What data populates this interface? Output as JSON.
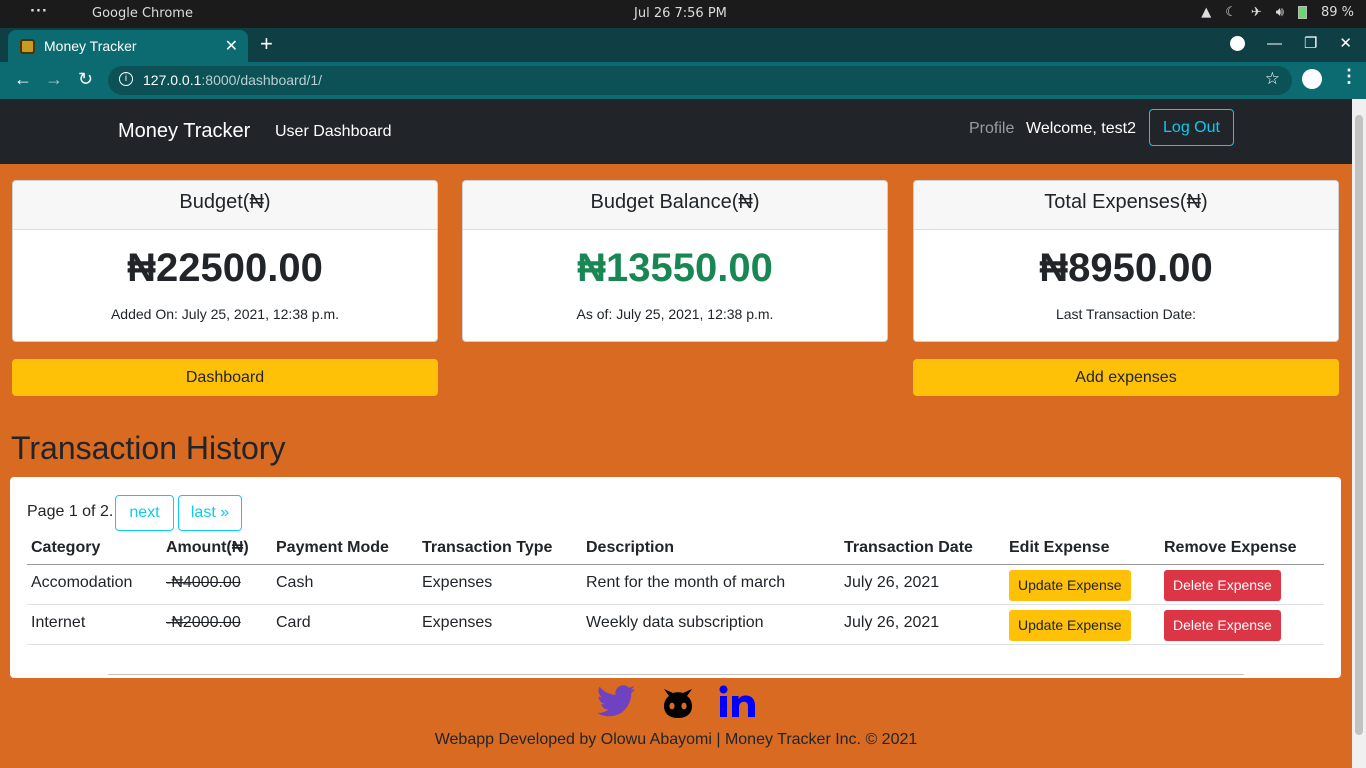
{
  "os": {
    "app_name": "Google Chrome",
    "datetime": "Jul 26   7:56 PM",
    "battery": "89 %"
  },
  "browser": {
    "tab_title": "Money Tracker",
    "url_host": "127.0.0.1",
    "url_rest": ":8000/dashboard/1/"
  },
  "nav": {
    "brand": "Money Tracker",
    "link": "User Dashboard",
    "profile": "Profile",
    "welcome": "Welcome, test2",
    "logout": "Log Out"
  },
  "cards": [
    {
      "title": "Budget(₦)",
      "value": "₦22500.00",
      "sub": "Added On: July 25, 2021, 12:38 p.m."
    },
    {
      "title": "Budget Balance(₦)",
      "value": "₦13550.00",
      "sub": "As of: July 25, 2021, 12:38 p.m."
    },
    {
      "title": "Total Expenses(₦)",
      "value": "₦8950.00",
      "sub": "Last Transaction Date:"
    }
  ],
  "buttons": {
    "dashboard": "Dashboard",
    "add_expenses": "Add expenses"
  },
  "history": {
    "title": "Transaction History",
    "page_info": "Page 1 of 2.",
    "next": "next",
    "last": "last »",
    "columns": [
      "Category",
      "Amount(₦)",
      "Payment Mode",
      "Transaction Type",
      "Description",
      "Transaction Date",
      "Edit Expense",
      "Remove Expense"
    ],
    "rows": [
      {
        "category": "Accomodation",
        "amount": "-₦4000.00",
        "mode": "Cash",
        "type": "Expenses",
        "description": "Rent for the month of march",
        "date": "July 26, 2021",
        "update": "Update Expense",
        "delete": "Delete Expense"
      },
      {
        "category": "Internet",
        "amount": "-₦2000.00",
        "mode": "Card",
        "type": "Expenses",
        "description": "Weekly data subscription",
        "date": "July 26, 2021",
        "update": "Update Expense",
        "delete": "Delete Expense"
      }
    ]
  },
  "footer": {
    "text": "Webapp Developed by Olowu Abayomi | Money Tracker Inc. © 2021",
    "icons": [
      "twitter-icon",
      "github-icon",
      "linkedin-icon"
    ],
    "colors": {
      "twitter": "#6f42c1",
      "github": "#000000",
      "linkedin": "#0000ff"
    }
  },
  "colors": {
    "page_bg": "#d96a22",
    "navbar": "#212529",
    "accent_yellow": "#ffc107",
    "balance_green": "#198754",
    "danger": "#dc3545",
    "info": "#0dcaf0"
  }
}
